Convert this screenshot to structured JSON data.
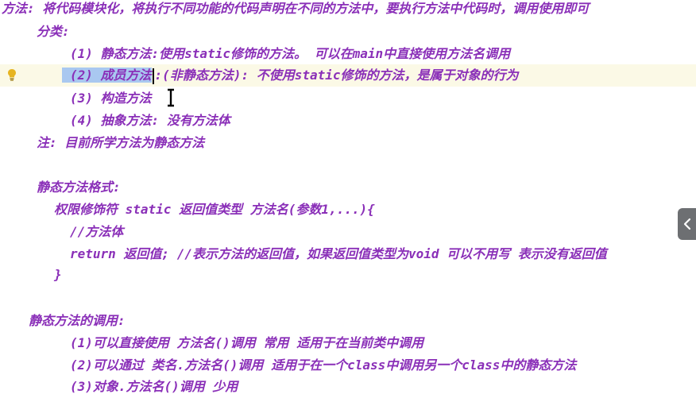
{
  "editor": {
    "lines": [
      "方法: 将代码模块化，将执行不同功能的代码声明在不同的方法中，要执行方法中代码时，调用使用即可",
      "分类:",
      "(1) 静态方法:使用static修饰的方法。 可以在main中直接使用方法名调用",
      "",
      "(3) 构造方法",
      "(4) 抽象方法: 没有方法体",
      "注:  目前所学方法为静态方法",
      "",
      "静态方法格式:",
      "权限修饰符 static 返回值类型 方法名(参数1,...){",
      "//方法体",
      "return 返回值; //表示方法的返回值，如果返回值类型为void 可以不用写 表示没有返回值",
      "}",
      "",
      "静态方法的调用:",
      "(1)可以直接使用 方法名()调用   常用   适用于在当前类中调用",
      "(2)可以通过 类名.方法名()调用 适用于在一个class中调用另一个class中的静态方法",
      "(3)对象.方法名()调用   少用"
    ],
    "current_line": {
      "selected": "(2) 成员方法",
      "after_caret": ":(非静态方法): 不使用static修饰的方法，是属于对象的行为"
    }
  },
  "icons": {
    "gutter": "lightbulb-icon",
    "cursor": "text-cursor-icon",
    "side_panel": "chevron-left-icon"
  },
  "colors": {
    "text": "#8a2fb8",
    "selection": "#a9c8f0",
    "current_line": "#fbf9e6",
    "bulb": "#e6b422",
    "side_tab": "#6d6f72"
  }
}
